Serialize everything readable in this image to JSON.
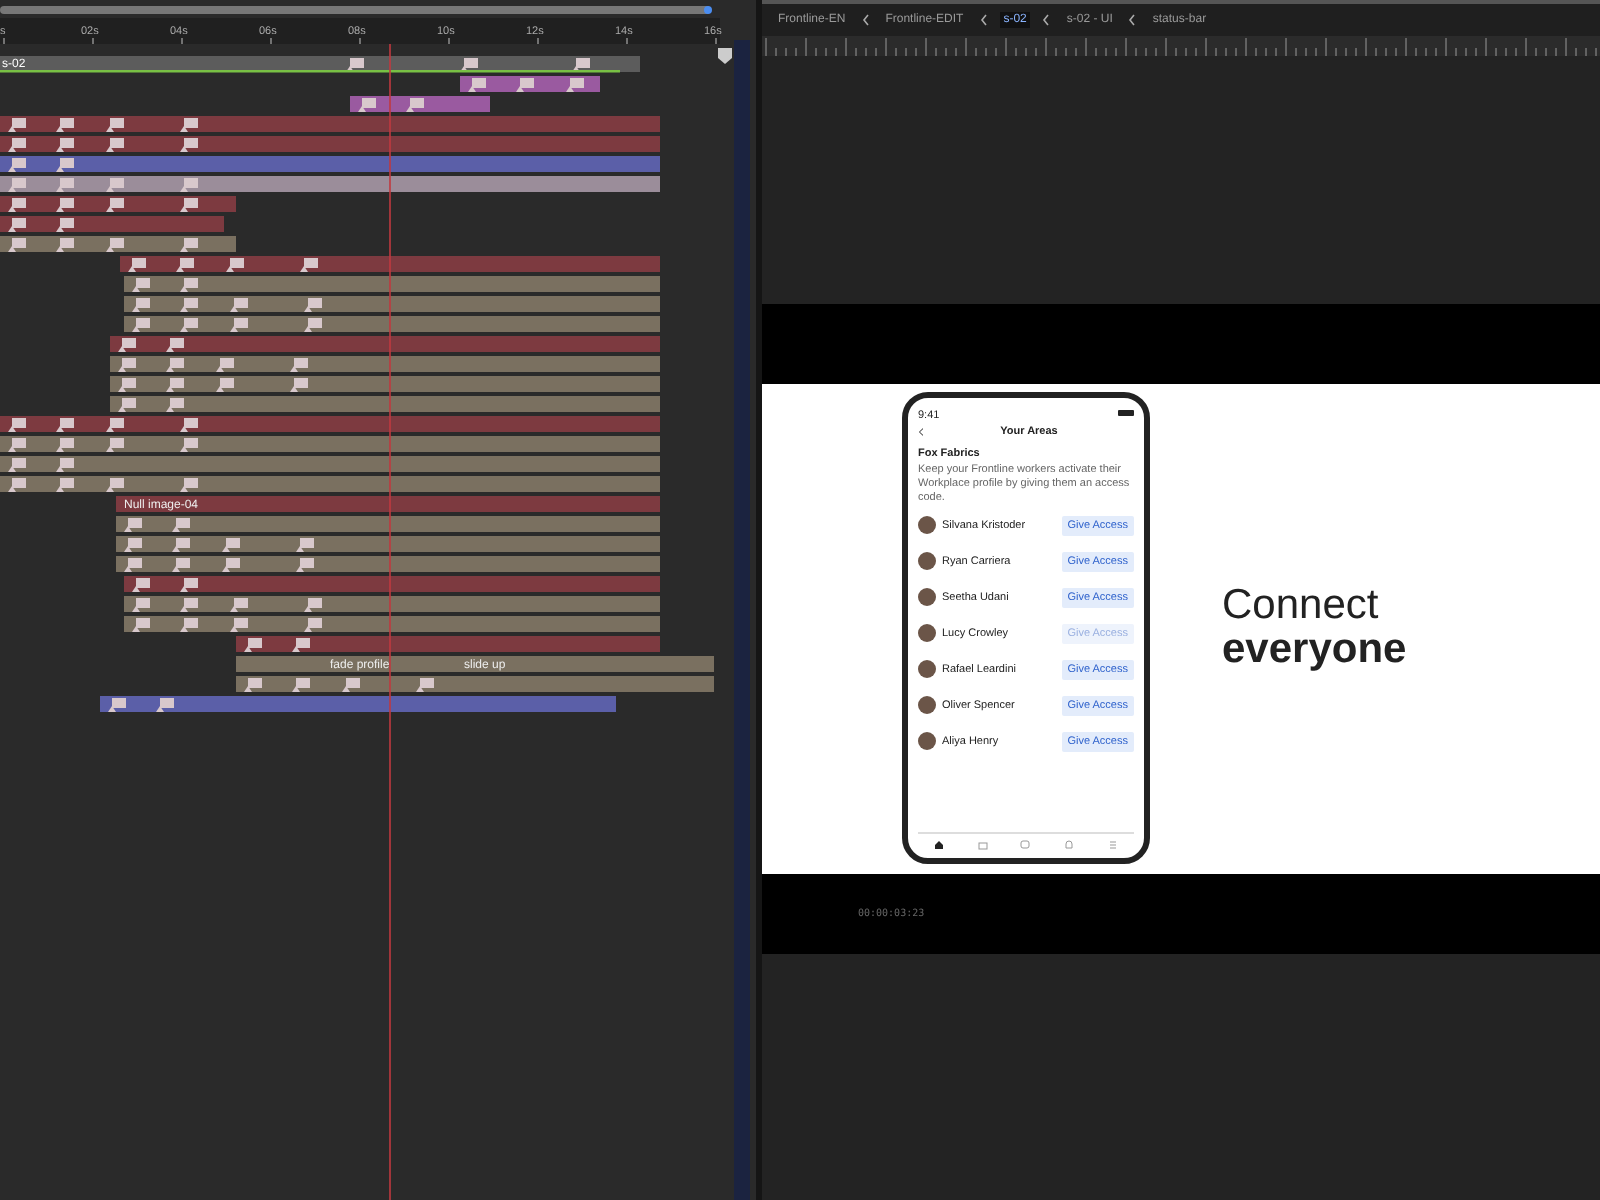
{
  "timeline": {
    "ruler": [
      "s",
      "02s",
      "04s",
      "06s",
      "08s",
      "10s",
      "12s",
      "14s",
      "16s"
    ],
    "work_area_label": "s-02",
    "layers": [
      {
        "color": "#5c5c5c"
      },
      {
        "color": "#9a5aa0"
      },
      {
        "color": "#9a5aa0"
      },
      {
        "color": "#7d3a40"
      },
      {
        "color": "#7d3a40"
      },
      {
        "color": "#5b5fa8"
      },
      {
        "color": "#9b8d9a"
      },
      {
        "color": "#7d3a40"
      },
      {
        "color": "#7d3a40"
      },
      {
        "color": "#7a7060"
      },
      {
        "color": "#7d3a40"
      },
      {
        "color": "#7a7060"
      },
      {
        "color": "#7a7060"
      },
      {
        "color": "#7a7060"
      },
      {
        "color": "#7d3a40"
      },
      {
        "color": "#7a7060"
      },
      {
        "color": "#7a7060"
      },
      {
        "color": "#7a7060"
      },
      {
        "color": "#7d3a40"
      },
      {
        "color": "#7a7060"
      },
      {
        "color": "#7a7060"
      },
      {
        "color": "#7a7060"
      },
      {
        "color": "#7d3a40",
        "labels": [
          "Null image-04"
        ]
      },
      {
        "color": "#7a7060"
      },
      {
        "color": "#7a7060"
      },
      {
        "color": "#7a7060"
      },
      {
        "color": "#7d3a40"
      },
      {
        "color": "#7a7060"
      },
      {
        "color": "#7a7060"
      },
      {
        "color": "#7d3a40"
      },
      {
        "color": "#7a7060",
        "labels": [
          "fade profile",
          "slide up"
        ]
      },
      {
        "color": "#7a7060"
      },
      {
        "color": "#5b5fa8"
      }
    ]
  },
  "breadcrumbs": [
    {
      "label": "Frontline-EN",
      "selected": false
    },
    {
      "label": "Frontline-EDIT",
      "selected": false
    },
    {
      "label": "s-02",
      "selected": true
    },
    {
      "label": "s-02 - UI",
      "selected": false
    },
    {
      "label": "status-bar",
      "selected": false
    }
  ],
  "preview": {
    "phone": {
      "time": "9:41",
      "title": "Your Areas",
      "section": "Fox Fabrics",
      "intro": "Keep your Frontline workers activate their Workplace profile by giving them an access code.",
      "people": [
        {
          "name": "Silvana Kristoder",
          "action": "Give Access",
          "disabled": false
        },
        {
          "name": "Ryan Carriera",
          "action": "Give Access",
          "disabled": false
        },
        {
          "name": "Seetha Udani",
          "action": "Give Access",
          "disabled": false
        },
        {
          "name": "Lucy Crowley",
          "action": "Give Access",
          "disabled": true
        },
        {
          "name": "Rafael Leardini",
          "action": "Give Access",
          "disabled": false
        },
        {
          "name": "Oliver Spencer",
          "action": "Give Access",
          "disabled": false
        },
        {
          "name": "Aliya Henry",
          "action": "Give Access",
          "disabled": false
        }
      ]
    },
    "headline": [
      "Connect",
      "everyone"
    ],
    "timecode": "00:00:03:23"
  }
}
